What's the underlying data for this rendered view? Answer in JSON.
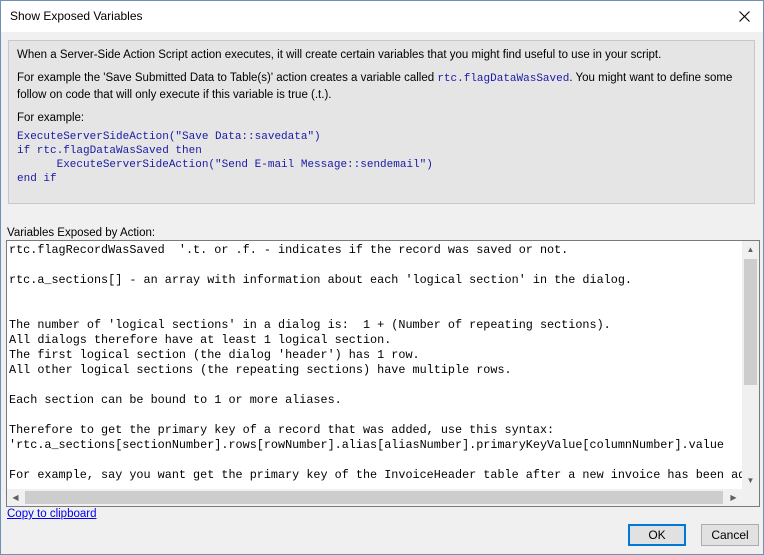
{
  "window": {
    "title": "Show Exposed Variables"
  },
  "info": {
    "para1": "When a Server-Side Action Script action executes, it will create certain variables that you might find useful to use in your script.",
    "para2_before": "For example the 'Save Submitted Data to Table(s)' action creates a variable called ",
    "para2_code": "rtc.flagDataWasSaved",
    "para2_after": ". You might want to define some follow on code that will only execute if this variable is true (.t.).",
    "para3": "For example:",
    "code_lines": [
      "ExecuteServerSideAction(\"Save Data::savedata\")",
      "if rtc.flagDataWasSaved then",
      "      ExecuteServerSideAction(\"Send E-mail Message::sendemail\")",
      "end if"
    ]
  },
  "variables": {
    "label": "Variables Exposed by Action:",
    "text_lines": [
      "rtc.flagRecordWasSaved  '.t. or .f. - indicates if the record was saved or not.",
      "",
      "rtc.a_sections[] - an array with information about each 'logical section' in the dialog.",
      "",
      "",
      "The number of 'logical sections' in a dialog is:  1 + (Number of repeating sections).",
      "All dialogs therefore have at least 1 logical section.",
      "The first logical section (the dialog 'header') has 1 row.",
      "All other logical sections (the repeating sections) have multiple rows.",
      "",
      "Each section can be bound to 1 or more aliases.",
      "",
      "Therefore to get the primary key of a record that was added, use this syntax:",
      "'rtc.a_sections[sectionNumber].rows[rowNumber].alias[aliasNumber].primaryKeyValue[columnNumber].value",
      "",
      "For example, say you want get the primary key of the InvoiceHeader table after a new invoice has been added"
    ]
  },
  "footer": {
    "copy_link": "Copy to clipboard",
    "ok_label": "OK",
    "cancel_label": "Cancel"
  },
  "colors": {
    "code_blue": "#1a1aa6",
    "link_blue": "#0000ee",
    "default_button_border": "#0078d7"
  },
  "icons": {
    "close": "close-icon",
    "scroll_up": "arrow-up-icon",
    "scroll_down": "arrow-down-icon",
    "scroll_left": "arrow-left-icon",
    "scroll_right": "arrow-right-icon"
  }
}
